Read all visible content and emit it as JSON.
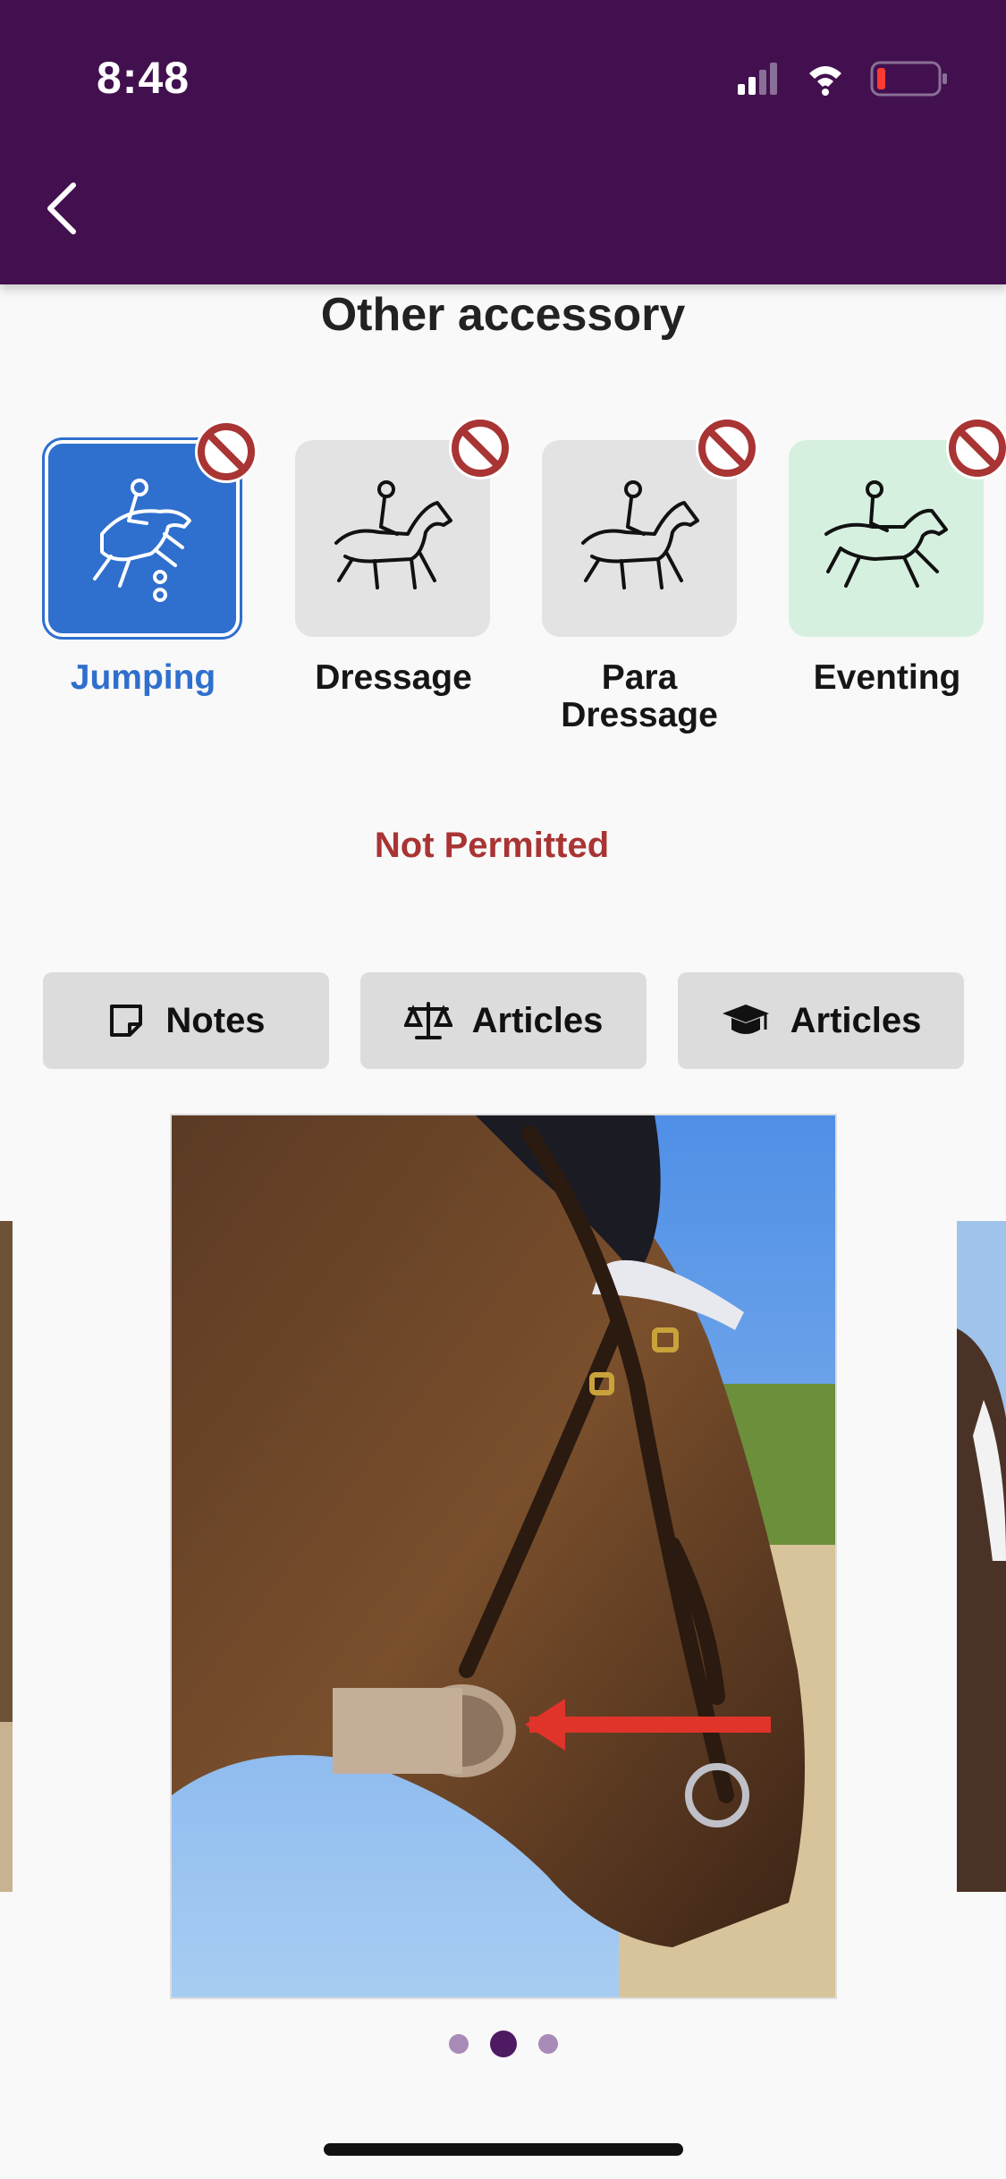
{
  "status_bar": {
    "time": "8:48"
  },
  "page": {
    "title": "Other accessory",
    "status": "Not Permitted"
  },
  "disciplines": [
    {
      "label": "Jumping"
    },
    {
      "label": "Dressage"
    },
    {
      "label": "Para Dressage"
    },
    {
      "label": "Eventing"
    }
  ],
  "actions": {
    "notes_label": "Notes",
    "rules_articles_label": "Articles",
    "education_articles_label": "Articles"
  },
  "carousel": {
    "current_index": 2,
    "total": 3
  },
  "colors": {
    "header": "#42104f",
    "selected": "#2f6fce",
    "not_permitted": "#a93434",
    "eventing_tile": "#d6f0e0"
  },
  "icons": [
    "back-chevron-icon",
    "signal-icon",
    "wifi-icon",
    "battery-icon",
    "prohibited-icon",
    "jumping-horse-icon",
    "dressage-horse-icon",
    "eventing-horse-icon",
    "notes-icon",
    "scales-icon",
    "graduation-cap-icon"
  ]
}
